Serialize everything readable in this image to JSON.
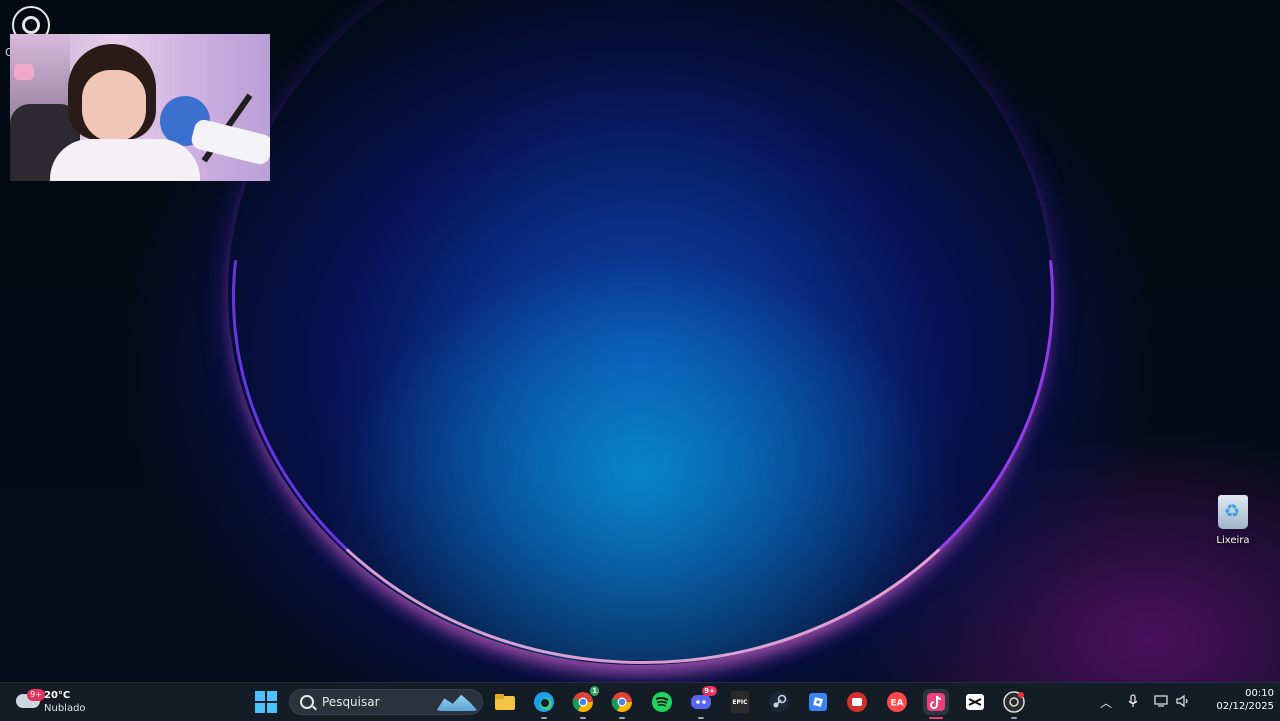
{
  "desktop": {
    "recycle_bin_label": "Lixeira",
    "obs_label": "O"
  },
  "taskbar": {
    "weather": {
      "temperature": "20°C",
      "condition": "Nublado",
      "badge": "9+"
    },
    "search": {
      "placeholder": "Pesquisar"
    },
    "apps": [
      {
        "name": "File Explorer",
        "icon": "folder-icon"
      },
      {
        "name": "Microsoft Edge",
        "icon": "edge-icon"
      },
      {
        "name": "Google Chrome (profile)",
        "icon": "chrome-icon",
        "badge": "1"
      },
      {
        "name": "Google Chrome",
        "icon": "chrome-icon"
      },
      {
        "name": "Spotify",
        "icon": "spotify-icon"
      },
      {
        "name": "Discord",
        "icon": "discord-icon",
        "badge": "9+"
      },
      {
        "name": "Epic Games",
        "icon": "epic-games-icon",
        "label": "EPIC"
      },
      {
        "name": "Steam",
        "icon": "steam-icon"
      },
      {
        "name": "Roblox",
        "icon": "roblox-icon"
      },
      {
        "name": "App",
        "icon": "red-app-icon"
      },
      {
        "name": "EA",
        "icon": "ea-icon"
      },
      {
        "name": "TikTok",
        "icon": "tiktok-icon",
        "active": true
      },
      {
        "name": "CapCut",
        "icon": "capcut-icon"
      },
      {
        "name": "OBS Studio",
        "icon": "obs-icon"
      }
    ],
    "clock": {
      "time": "00:10",
      "date": "02/12/2025"
    }
  },
  "colors": {
    "taskbar_bg": "#141c26",
    "accent": "#4cc2ff",
    "active_indicator": "#ec407a",
    "badge": "#e3335a"
  }
}
